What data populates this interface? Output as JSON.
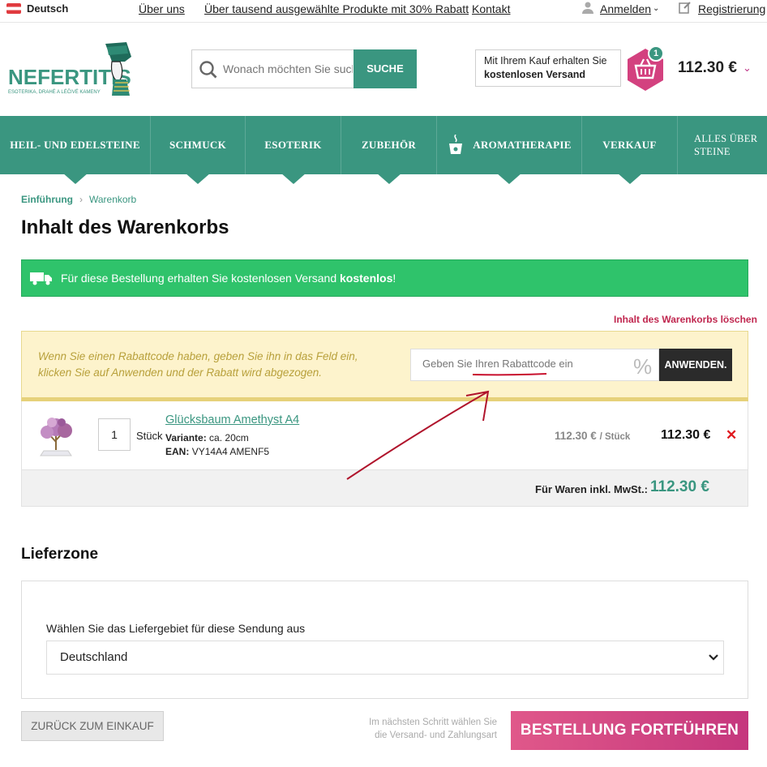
{
  "topbar": {
    "language": "Deutsch",
    "links": [
      "Über uns",
      "Über tausend ausgewählte Produkte mit 30% Rabatt",
      "Kontakt"
    ],
    "login": "Anmelden",
    "register": "Registrierung"
  },
  "header": {
    "logo_name": "NEFERTITIS",
    "logo_tagline": "ESOTERIKA, DRAHÉ A LÉČIVÉ KAMENY",
    "search_placeholder": "Wonach möchten Sie suchen?",
    "search_button": "SUCHE",
    "shipping_line1": "Mit Ihrem Kauf erhalten Sie",
    "shipping_line2": "kostenlosen Versand",
    "cart_count": "1",
    "cart_total": "112.30 €"
  },
  "nav": {
    "items": [
      "HEIL- UND EDELSTEINE",
      "SCHMUCK",
      "ESOTERIK",
      "ZUBEHÖR",
      "AROMATHERAPIE",
      "VERKAUF"
    ],
    "last_line1": "ALLES ÜBER",
    "last_line2": "STEINE"
  },
  "breadcrumb": {
    "home": "Einführung",
    "current": "Warenkorb"
  },
  "page_title": "Inhalt des Warenkorbs",
  "alert": {
    "text": "Für diese Bestellung erhalten Sie kostenlosen Versand ",
    "bold": "kostenlos",
    "end": "!"
  },
  "clear_cart": "Inhalt des Warenkorbs löschen",
  "coupon": {
    "info": "Wenn Sie einen Rabattcode haben, geben Sie ihn in das Feld ein, klicken Sie auf Anwenden und der Rabatt wird abgezogen.",
    "placeholder": "Geben Sie Ihren Rabattcode ein",
    "percent_icon": "%",
    "apply": "ANWENDEN."
  },
  "item": {
    "quantity": "1",
    "unit": "Stück",
    "name": "Glücksbaum Amethyst A4",
    "variant_label": "Variante:",
    "variant": "ca. 20cm",
    "ean_label": "EAN:",
    "ean": "VY14A4 AMENF5",
    "unit_price": "112.30 €",
    "unit_price_suffix": "/ Stück",
    "line_total": "112.30 €",
    "remove": "✕"
  },
  "summary": {
    "label": "Für Waren inkl. MwSt.:",
    "total": "112.30 €"
  },
  "delivery": {
    "title": "Lieferzone",
    "label": "Wählen Sie das Liefergebiet für diese Sendung aus",
    "selected": "Deutschland"
  },
  "footer": {
    "back": "ZURÜCK ZUM EINKAUF",
    "hint_line1": "Im nächsten Schritt wählen Sie",
    "hint_line2": "die Versand- und Zahlungsart",
    "continue": "BESTELLUNG FORTFÜHREN"
  },
  "colors": {
    "brand": "#3a9680",
    "success": "#2fc36b",
    "accent": "#c5377d",
    "danger": "#e0191f"
  }
}
